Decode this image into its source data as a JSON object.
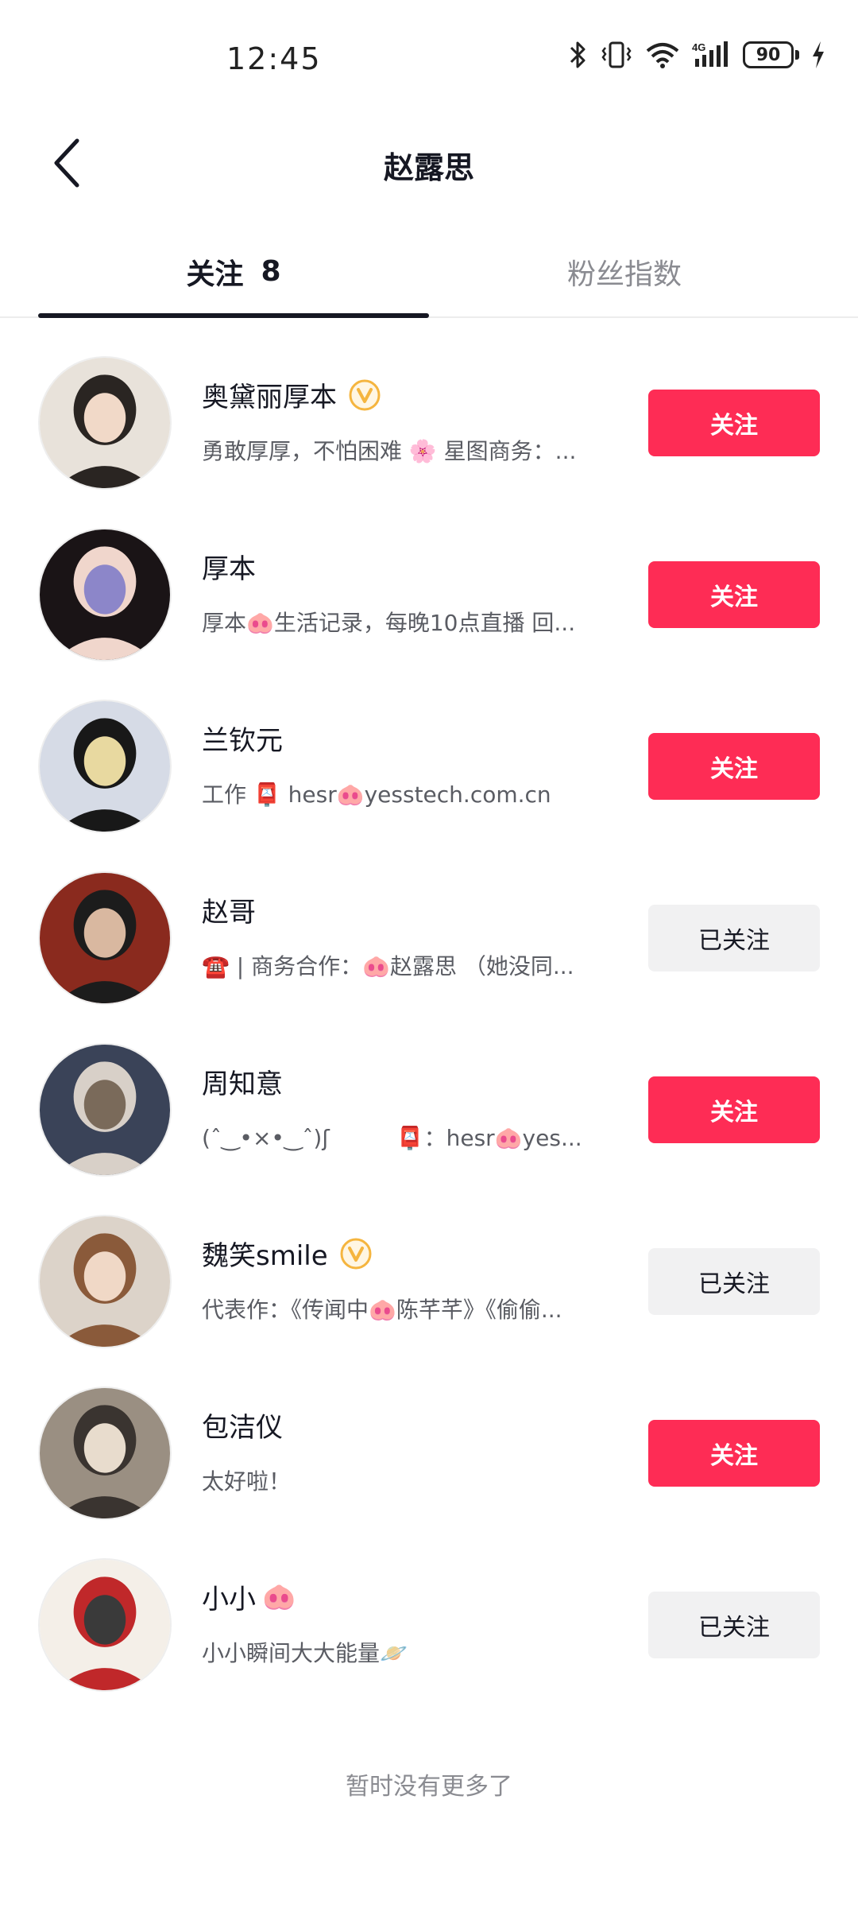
{
  "status_bar": {
    "time": "12:45",
    "battery": "90"
  },
  "nav": {
    "title": "赵露思"
  },
  "tabs": [
    {
      "label": "关注",
      "count": "8"
    },
    {
      "label": "粉丝指数"
    }
  ],
  "users": [
    {
      "name": "奥黛丽厚本",
      "verified": true,
      "bio": "勇敢厚厚，不怕困难 🌸 星图商务：...",
      "button": "关注",
      "followed": false,
      "avatar_colors": [
        "#e8e2da",
        "#2a2522",
        "#f1d9c8"
      ]
    },
    {
      "name": "厚本",
      "verified": false,
      "bio": "厚本🐽生活记录，每晚10点直播 回...",
      "button": "关注",
      "followed": false,
      "avatar_colors": [
        "#1a1416",
        "#f0d6cc",
        "#8c86c9"
      ]
    },
    {
      "name": "兰钦元",
      "verified": false,
      "bio": "工作 📮 hesr🐽yesstech.com.cn",
      "button": "关注",
      "followed": false,
      "avatar_colors": [
        "#d6dbe6",
        "#181818",
        "#e8d9a0"
      ]
    },
    {
      "name": "赵哥",
      "verified": false,
      "bio": "☎️ | 商务合作：🐽赵露思 （她没同...",
      "button": "已关注",
      "followed": true,
      "avatar_colors": [
        "#8a2a1e",
        "#1c1c1c",
        "#d9b8a0"
      ]
    },
    {
      "name": "周知意",
      "verified": false,
      "bio": "(ˆ‿•×•‿ˆ)ʃ　　　📮：hesr🐽yes...",
      "button": "关注",
      "followed": false,
      "avatar_colors": [
        "#3a4358",
        "#d8d0c8",
        "#7a6a5a"
      ]
    },
    {
      "name": "魏笑smile",
      "verified": true,
      "bio": "代表作：《传闻中🐽陈芊芊》《偷偷...",
      "button": "已关注",
      "followed": true,
      "avatar_colors": [
        "#dcd3c9",
        "#8a5a3a",
        "#f0d8c6"
      ]
    },
    {
      "name": "包洁仪",
      "verified": false,
      "bio": "太好啦！",
      "button": "关注",
      "followed": false,
      "avatar_colors": [
        "#9a8f82",
        "#3a3430",
        "#e8dccd"
      ]
    },
    {
      "name": "小小",
      "verified": false,
      "name_extra": "🐽",
      "bio": "小小瞬间大大能量🪐",
      "button": "已关注",
      "followed": true,
      "avatar_colors": [
        "#f4efe8",
        "#c0282a",
        "#3a3a3a"
      ]
    }
  ],
  "footer": {
    "end_text": "暂时没有更多了"
  },
  "colors": {
    "accent": "#fe2c55",
    "secondary_button": "#f1f1f2",
    "verified": "#f5b53f"
  },
  "icons": {
    "back": "chevron-left-icon",
    "verified": "verified-v-icon",
    "bluetooth": "bluetooth-icon",
    "vibrate": "vibrate-icon",
    "wifi": "wifi-icon",
    "signal": "signal-4g-icon",
    "charging": "bolt-icon"
  }
}
